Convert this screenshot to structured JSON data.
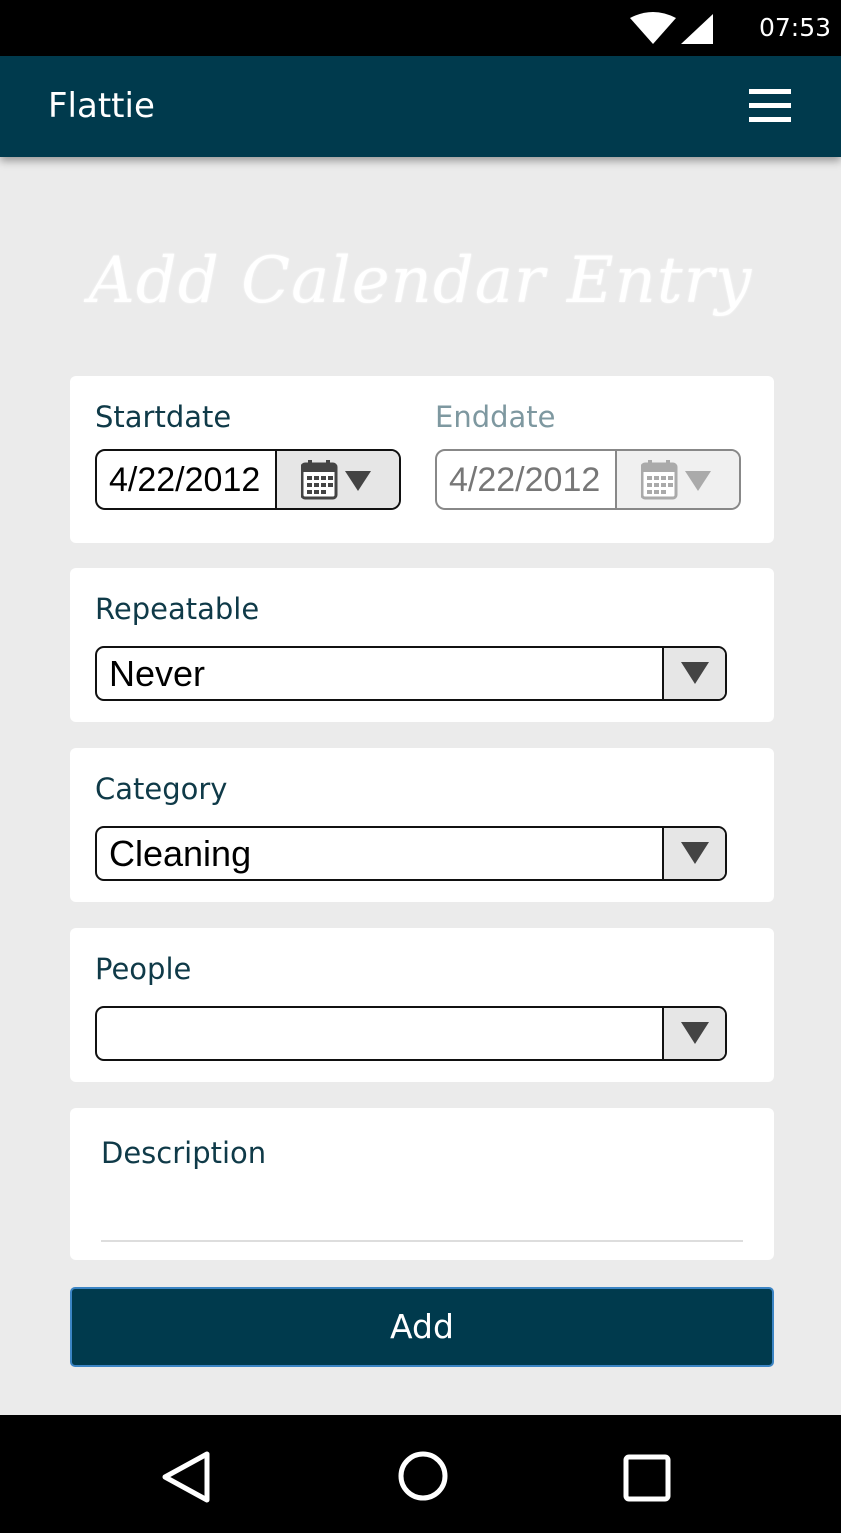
{
  "status_bar": {
    "time": "07:53"
  },
  "app_bar": {
    "title": "Flattie",
    "menu_icon": "menu-icon"
  },
  "page": {
    "heading": "Add Calendar Entry"
  },
  "form": {
    "startdate": {
      "label": "Startdate",
      "value": "4/22/2012"
    },
    "enddate": {
      "label": "Enddate",
      "value": "4/22/2012"
    },
    "repeatable": {
      "label": "Repeatable",
      "value": "Never"
    },
    "category": {
      "label": "Category",
      "value": "Cleaning"
    },
    "people": {
      "label": "People",
      "value": ""
    },
    "description": {
      "label": "Description",
      "value": ""
    },
    "submit_label": "Add"
  },
  "colors": {
    "primary": "#003a4d",
    "background": "#ebebeb",
    "label": "#0f3a48",
    "disabled_label": "#7e98a0"
  }
}
